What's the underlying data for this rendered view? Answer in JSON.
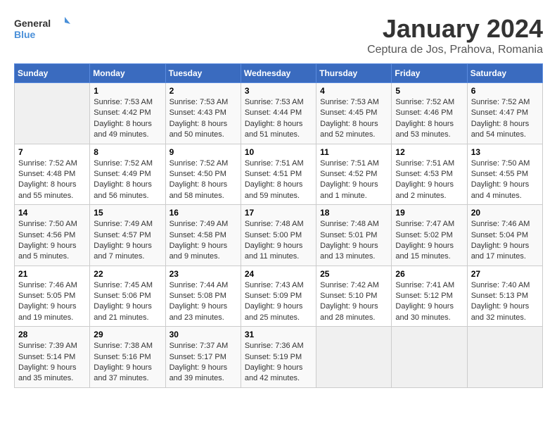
{
  "logo": {
    "text_general": "General",
    "text_blue": "Blue"
  },
  "title": "January 2024",
  "subtitle": "Ceptura de Jos, Prahova, Romania",
  "headers": [
    "Sunday",
    "Monday",
    "Tuesday",
    "Wednesday",
    "Thursday",
    "Friday",
    "Saturday"
  ],
  "weeks": [
    [
      {
        "day": "",
        "info": ""
      },
      {
        "day": "1",
        "info": "Sunrise: 7:53 AM\nSunset: 4:42 PM\nDaylight: 8 hours\nand 49 minutes."
      },
      {
        "day": "2",
        "info": "Sunrise: 7:53 AM\nSunset: 4:43 PM\nDaylight: 8 hours\nand 50 minutes."
      },
      {
        "day": "3",
        "info": "Sunrise: 7:53 AM\nSunset: 4:44 PM\nDaylight: 8 hours\nand 51 minutes."
      },
      {
        "day": "4",
        "info": "Sunrise: 7:53 AM\nSunset: 4:45 PM\nDaylight: 8 hours\nand 52 minutes."
      },
      {
        "day": "5",
        "info": "Sunrise: 7:52 AM\nSunset: 4:46 PM\nDaylight: 8 hours\nand 53 minutes."
      },
      {
        "day": "6",
        "info": "Sunrise: 7:52 AM\nSunset: 4:47 PM\nDaylight: 8 hours\nand 54 minutes."
      }
    ],
    [
      {
        "day": "7",
        "info": "Sunrise: 7:52 AM\nSunset: 4:48 PM\nDaylight: 8 hours\nand 55 minutes."
      },
      {
        "day": "8",
        "info": "Sunrise: 7:52 AM\nSunset: 4:49 PM\nDaylight: 8 hours\nand 56 minutes."
      },
      {
        "day": "9",
        "info": "Sunrise: 7:52 AM\nSunset: 4:50 PM\nDaylight: 8 hours\nand 58 minutes."
      },
      {
        "day": "10",
        "info": "Sunrise: 7:51 AM\nSunset: 4:51 PM\nDaylight: 8 hours\nand 59 minutes."
      },
      {
        "day": "11",
        "info": "Sunrise: 7:51 AM\nSunset: 4:52 PM\nDaylight: 9 hours\nand 1 minute."
      },
      {
        "day": "12",
        "info": "Sunrise: 7:51 AM\nSunset: 4:53 PM\nDaylight: 9 hours\nand 2 minutes."
      },
      {
        "day": "13",
        "info": "Sunrise: 7:50 AM\nSunset: 4:55 PM\nDaylight: 9 hours\nand 4 minutes."
      }
    ],
    [
      {
        "day": "14",
        "info": "Sunrise: 7:50 AM\nSunset: 4:56 PM\nDaylight: 9 hours\nand 5 minutes."
      },
      {
        "day": "15",
        "info": "Sunrise: 7:49 AM\nSunset: 4:57 PM\nDaylight: 9 hours\nand 7 minutes."
      },
      {
        "day": "16",
        "info": "Sunrise: 7:49 AM\nSunset: 4:58 PM\nDaylight: 9 hours\nand 9 minutes."
      },
      {
        "day": "17",
        "info": "Sunrise: 7:48 AM\nSunset: 5:00 PM\nDaylight: 9 hours\nand 11 minutes."
      },
      {
        "day": "18",
        "info": "Sunrise: 7:48 AM\nSunset: 5:01 PM\nDaylight: 9 hours\nand 13 minutes."
      },
      {
        "day": "19",
        "info": "Sunrise: 7:47 AM\nSunset: 5:02 PM\nDaylight: 9 hours\nand 15 minutes."
      },
      {
        "day": "20",
        "info": "Sunrise: 7:46 AM\nSunset: 5:04 PM\nDaylight: 9 hours\nand 17 minutes."
      }
    ],
    [
      {
        "day": "21",
        "info": "Sunrise: 7:46 AM\nSunset: 5:05 PM\nDaylight: 9 hours\nand 19 minutes."
      },
      {
        "day": "22",
        "info": "Sunrise: 7:45 AM\nSunset: 5:06 PM\nDaylight: 9 hours\nand 21 minutes."
      },
      {
        "day": "23",
        "info": "Sunrise: 7:44 AM\nSunset: 5:08 PM\nDaylight: 9 hours\nand 23 minutes."
      },
      {
        "day": "24",
        "info": "Sunrise: 7:43 AM\nSunset: 5:09 PM\nDaylight: 9 hours\nand 25 minutes."
      },
      {
        "day": "25",
        "info": "Sunrise: 7:42 AM\nSunset: 5:10 PM\nDaylight: 9 hours\nand 28 minutes."
      },
      {
        "day": "26",
        "info": "Sunrise: 7:41 AM\nSunset: 5:12 PM\nDaylight: 9 hours\nand 30 minutes."
      },
      {
        "day": "27",
        "info": "Sunrise: 7:40 AM\nSunset: 5:13 PM\nDaylight: 9 hours\nand 32 minutes."
      }
    ],
    [
      {
        "day": "28",
        "info": "Sunrise: 7:39 AM\nSunset: 5:14 PM\nDaylight: 9 hours\nand 35 minutes."
      },
      {
        "day": "29",
        "info": "Sunrise: 7:38 AM\nSunset: 5:16 PM\nDaylight: 9 hours\nand 37 minutes."
      },
      {
        "day": "30",
        "info": "Sunrise: 7:37 AM\nSunset: 5:17 PM\nDaylight: 9 hours\nand 39 minutes."
      },
      {
        "day": "31",
        "info": "Sunrise: 7:36 AM\nSunset: 5:19 PM\nDaylight: 9 hours\nand 42 minutes."
      },
      {
        "day": "",
        "info": ""
      },
      {
        "day": "",
        "info": ""
      },
      {
        "day": "",
        "info": ""
      }
    ]
  ]
}
